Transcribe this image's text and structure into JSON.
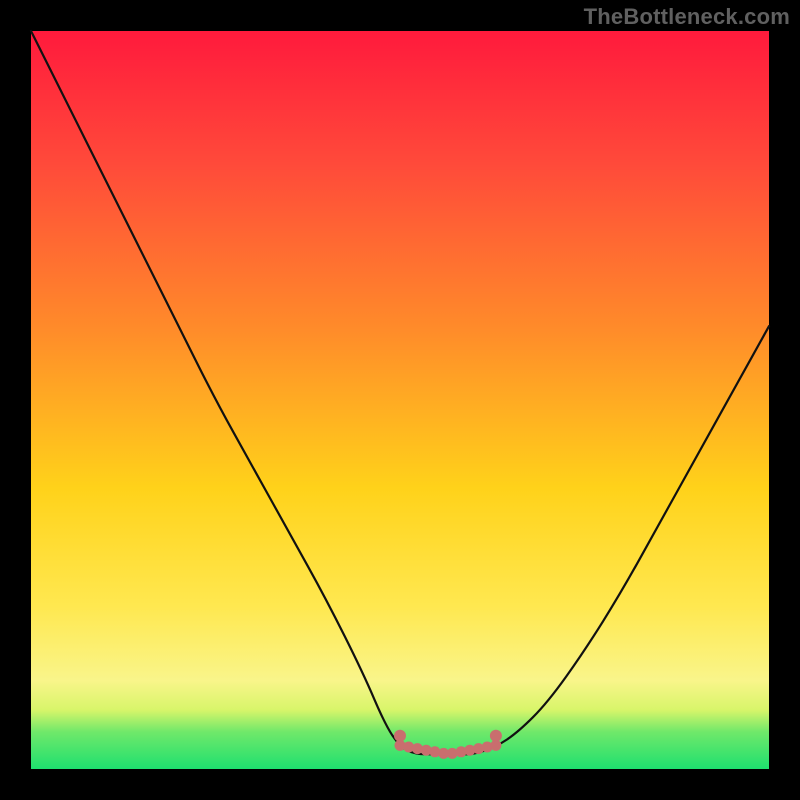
{
  "watermark": "TheBottleneck.com",
  "colors": {
    "background": "#000000",
    "gradient_top": "#ff1a3c",
    "gradient_mid1": "#ff8a2a",
    "gradient_mid2": "#ffd21a",
    "gradient_bottom": "#1ee06f",
    "curve": "#111111",
    "dots": "#c96e6e"
  },
  "chart_data": {
    "type": "line",
    "title": "",
    "xlabel": "",
    "ylabel": "",
    "xlim": [
      0,
      100
    ],
    "ylim": [
      0,
      100
    ],
    "series": [
      {
        "name": "bottleneck-curve",
        "x": [
          0,
          5,
          10,
          15,
          20,
          25,
          30,
          35,
          40,
          45,
          48,
          50,
          52,
          55,
          58,
          60,
          63,
          66,
          70,
          75,
          80,
          85,
          90,
          95,
          100
        ],
        "y": [
          100,
          90,
          80,
          70,
          60,
          50,
          41,
          32,
          23,
          13,
          6,
          3,
          2,
          2,
          2,
          2,
          3,
          5,
          9,
          16,
          24,
          33,
          42,
          51,
          60
        ]
      }
    ],
    "flat_region": {
      "x_start": 50,
      "x_end": 63,
      "y": 2,
      "marker_count": 12
    }
  }
}
